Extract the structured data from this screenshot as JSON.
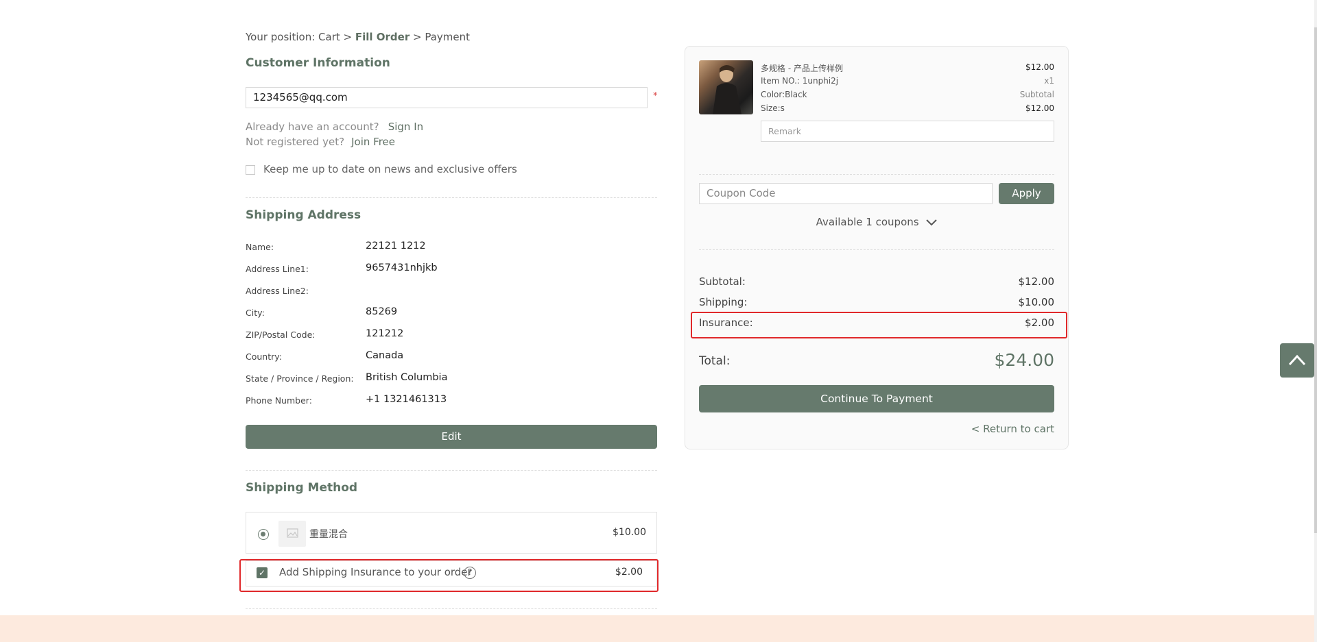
{
  "breadcrumb": {
    "prefix": "Your position: Cart >",
    "current": "Fill Order",
    "suffix": "> Payment"
  },
  "customer": {
    "title": "Customer Information",
    "email_value": "1234565@qq.com",
    "required_mark": "*",
    "account_prompt": "Already have an account?",
    "sign_in": "Sign In",
    "register_prompt": "Not registered yet?",
    "join_free": "Join Free",
    "newsletter": "Keep me up to date on news and exclusive offers"
  },
  "shipping_address": {
    "title": "Shipping Address",
    "rows": [
      {
        "label": "Name:",
        "value": "22121 1212"
      },
      {
        "label": "Address Line1:",
        "value": "9657431nhjkb"
      },
      {
        "label": "Address Line2:",
        "value": ""
      },
      {
        "label": "City:",
        "value": "85269"
      },
      {
        "label": "ZIP/Postal Code:",
        "value": "121212"
      },
      {
        "label": "Country:",
        "value": "Canada"
      },
      {
        "label": "State / Province / Region:",
        "value": "British Columbia"
      },
      {
        "label": "Phone Number:",
        "value": "+1 1321461313"
      }
    ],
    "edit_label": "Edit"
  },
  "shipping_method": {
    "title": "Shipping Method",
    "option_name": "重量混合",
    "option_price": "$10.00",
    "insurance_label": "Add Shipping Insurance to your order",
    "insurance_price": "$2.00",
    "insurance_checked": true
  },
  "summary": {
    "product": {
      "name": "多规格 - 产品上传样例",
      "price": "$12.00",
      "item_no": "Item NO.: 1unphi2j",
      "qty": "x1",
      "color": "Color:Black",
      "subtotal_label": "Subtotal",
      "size": "Size:s",
      "subtotal_value": "$12.00"
    },
    "remark_placeholder": "Remark",
    "coupon_placeholder": "Coupon Code",
    "apply_label": "Apply",
    "available_coupons": "Available 1 coupons",
    "subtotal_label": "Subtotal:",
    "subtotal_value": "$12.00",
    "shipping_label": "Shipping:",
    "shipping_value": "$10.00",
    "insurance_label": "Insurance:",
    "insurance_value": "$2.00",
    "total_label": "Total:",
    "total_value": "$24.00",
    "continue_label": "Continue To Payment",
    "return_label": "< Return to cart"
  },
  "colors": {
    "accent": "#667a6d",
    "highlight": "#e0282a",
    "footer": "#fdeade"
  },
  "icons": {
    "back_to_top": "chevron-up-icon",
    "help": "question-icon",
    "dropdown": "chevron-down-icon"
  }
}
